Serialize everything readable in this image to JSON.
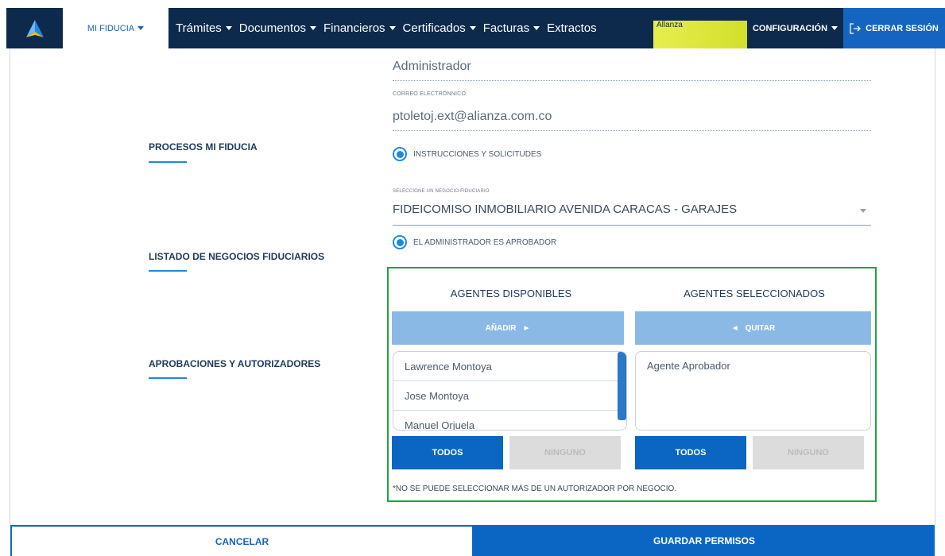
{
  "nav": {
    "logo_icon": "alianza-logo-icon",
    "active_item": "MI FIDUCIA",
    "menu": [
      "Trámites",
      "Documentos",
      "Financieros",
      "Certificados",
      "Facturas"
    ],
    "extractos": "Extractos",
    "brand": "Allanza",
    "config": "CONFIGURACIÓN",
    "logout": "CERRAR SESIÓN",
    "colors": {
      "bar": "#0d2a4c",
      "logout": "#1565c0",
      "brand": "#dde540"
    }
  },
  "user": {
    "role_value": "Administrador",
    "email_label": "CORREO ELECTRÓNNICO",
    "email_value": "ptoletoj.ext@alianza.com.co"
  },
  "sections": {
    "procesos": "PROCESOS MI FIDUCIA",
    "listado": "LISTADO DE NEGOCIOS FIDUCIARIOS",
    "aprobaciones": "APROBACIONES Y AUTORIZADORES"
  },
  "procesos": {
    "option": "INSTRUCCIONES Y SOLICITUDES"
  },
  "negocio": {
    "label": "SELECCIONE UN NEGOCIO FIDUCIARIO",
    "selected": "FIDEICOMISO INMOBILIARIO AVENIDA CARACAS - GARAJES",
    "approver_option": "EL ADMINISTRADOR ES APROBADOR"
  },
  "agents": {
    "available_title": "AGENTES DISPONIBLES",
    "selected_title": "AGENTES SELECCIONADOS",
    "add_label": "AÑADIR",
    "remove_label": "QUITAR",
    "available": [
      "Lawrence Montoya",
      "Jose Montoya",
      "Manuel Orjuela"
    ],
    "selected": [
      "Agente Aprobador"
    ],
    "all_label": "TODOS",
    "none_label": "NINGUNO",
    "note": "*NO SE PUEDE SELECCIONAR MÁS DE UN AUTORIZADOR POR NEGOCIO."
  },
  "footer": {
    "cancel": "CANCELAR",
    "save": "GUARDAR PERMISOS"
  }
}
